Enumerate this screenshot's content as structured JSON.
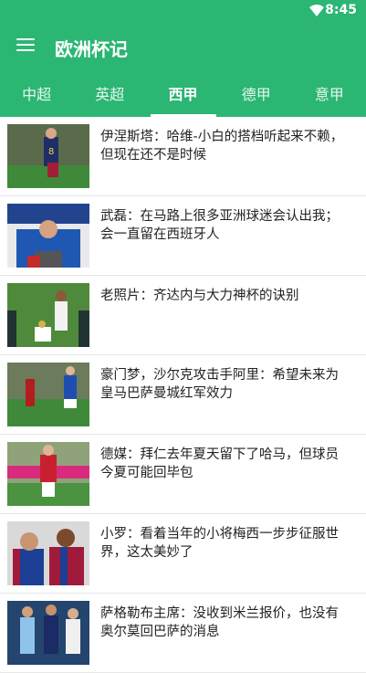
{
  "status": {
    "time": "8:45"
  },
  "app": {
    "title": "欧洲杯记"
  },
  "tabs": [
    "中超",
    "英超",
    "西甲",
    "德甲",
    "意甲"
  ],
  "active_tab": "西甲",
  "news": [
    {
      "title": "伊涅斯塔：哈维-小白的搭档听起来不赖，但现在还不是时候"
    },
    {
      "title": "武磊：在马路上很多亚洲球迷会认出我；会一直留在西班牙人"
    },
    {
      "title": "老照片：齐达内与大力神杯的诀别"
    },
    {
      "title": "豪门梦，沙尔克攻击手阿里：希望未来为皇马巴萨曼城红军效力"
    },
    {
      "title": "德媒：拜仁去年夏天留下了哈马，但球员今夏可能回毕包"
    },
    {
      "title": "小罗：看着当年的小将梅西一步步征服世界，这太美妙了"
    },
    {
      "title": "萨格勒布主席：没收到米兰报价，也没有奥尔莫回巴萨的消息"
    }
  ]
}
